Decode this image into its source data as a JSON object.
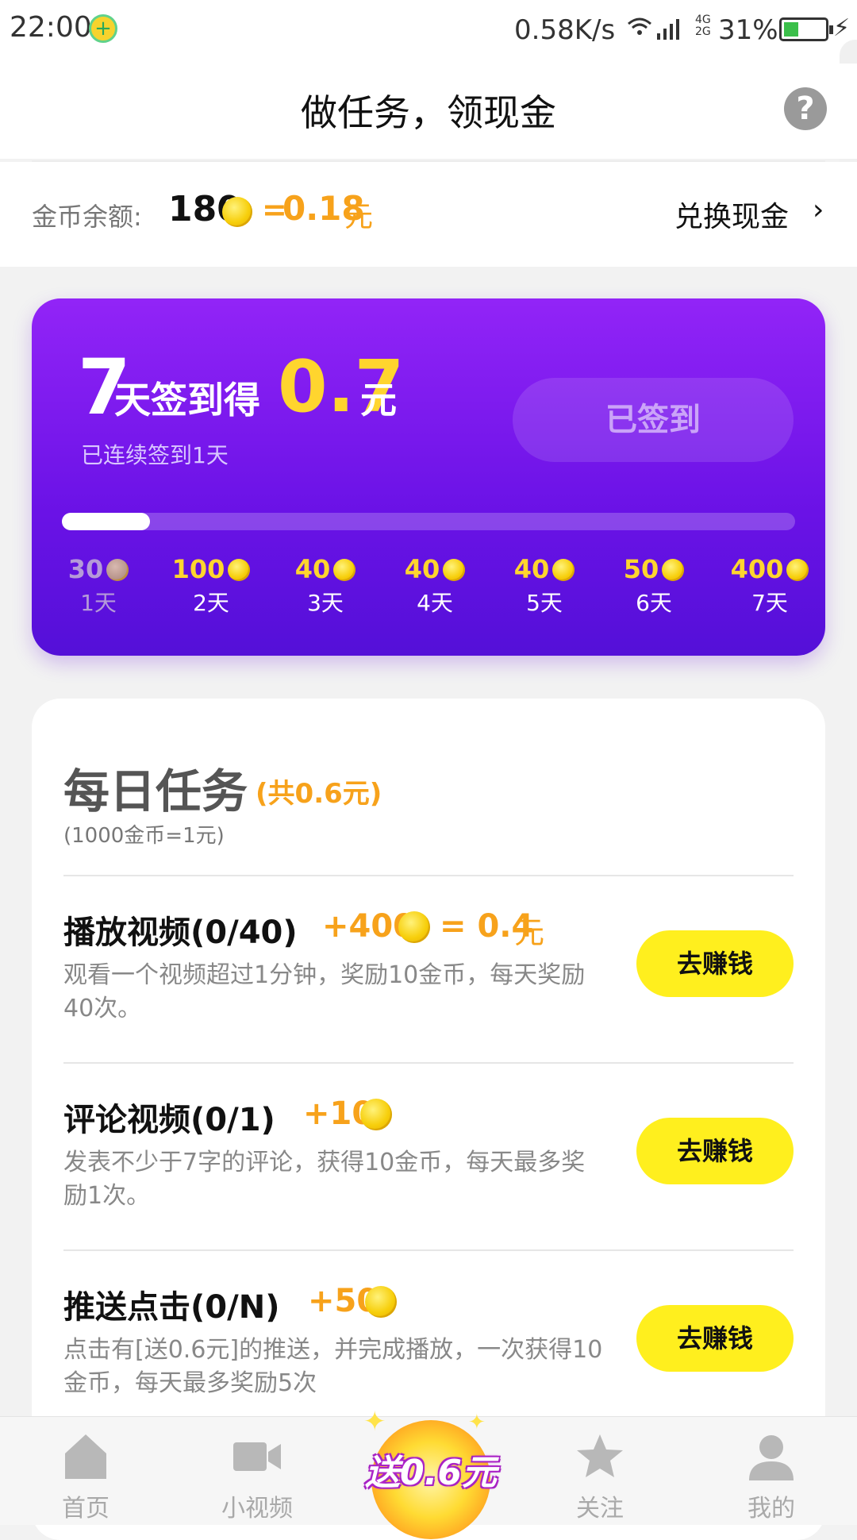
{
  "status_bar": {
    "time": "22:00",
    "net_speed": "0.58K/s",
    "network_labels": "4G\n2G",
    "battery": "31%"
  },
  "header": {
    "title": "做任务，领现金",
    "help_label": "?"
  },
  "balance": {
    "label": "金币余额:",
    "coins": "180",
    "equals": "=",
    "amount": "0.18",
    "unit": "元",
    "exchange_label": "兑换现金",
    "chevron": "›"
  },
  "sign_in": {
    "days_big": "7",
    "title_mid": "天签到得",
    "reward_amount": "0.7",
    "reward_unit": "元",
    "streak_text": "已连续签到1天",
    "button_label": "已签到",
    "progress_fraction": 0.12,
    "days": [
      {
        "coins": "30",
        "label": "1天",
        "done": true
      },
      {
        "coins": "100",
        "label": "2天",
        "done": false
      },
      {
        "coins": "40",
        "label": "3天",
        "done": false
      },
      {
        "coins": "40",
        "label": "4天",
        "done": false
      },
      {
        "coins": "40",
        "label": "5天",
        "done": false
      },
      {
        "coins": "50",
        "label": "6天",
        "done": false
      },
      {
        "coins": "400",
        "label": "7天",
        "done": false
      }
    ]
  },
  "daily_tasks": {
    "title": "每日任务",
    "total": "(共0.6元)",
    "rate_note": "(1000金币=1元)",
    "tasks": [
      {
        "name": "播放视频(0/40)",
        "reward": "+400",
        "equiv": "= 0.4",
        "equiv_unit": "元",
        "desc": "观看一个视频超过1分钟，奖励10金币，每天奖励40次。",
        "button": "去赚钱"
      },
      {
        "name": "评论视频(0/1)",
        "reward": "+10",
        "desc": "发表不少于7字的评论，获得10金币，每天最多奖励1次。",
        "button": "去赚钱"
      },
      {
        "name": "推送点击(0/N)",
        "reward": "+50",
        "desc": "点击有[送0.6元]的推送，并完成播放，一次获得10金币，每天最多奖励5次",
        "button": "去赚钱"
      }
    ]
  },
  "tab_bar": {
    "items": [
      {
        "label": "首页",
        "icon": "home-icon"
      },
      {
        "label": "小视频",
        "icon": "video-camera-icon"
      },
      {
        "label": "关注",
        "icon": "star-icon"
      },
      {
        "label": "我的",
        "icon": "person-icon"
      }
    ],
    "promo_label": "送0.6元"
  }
}
